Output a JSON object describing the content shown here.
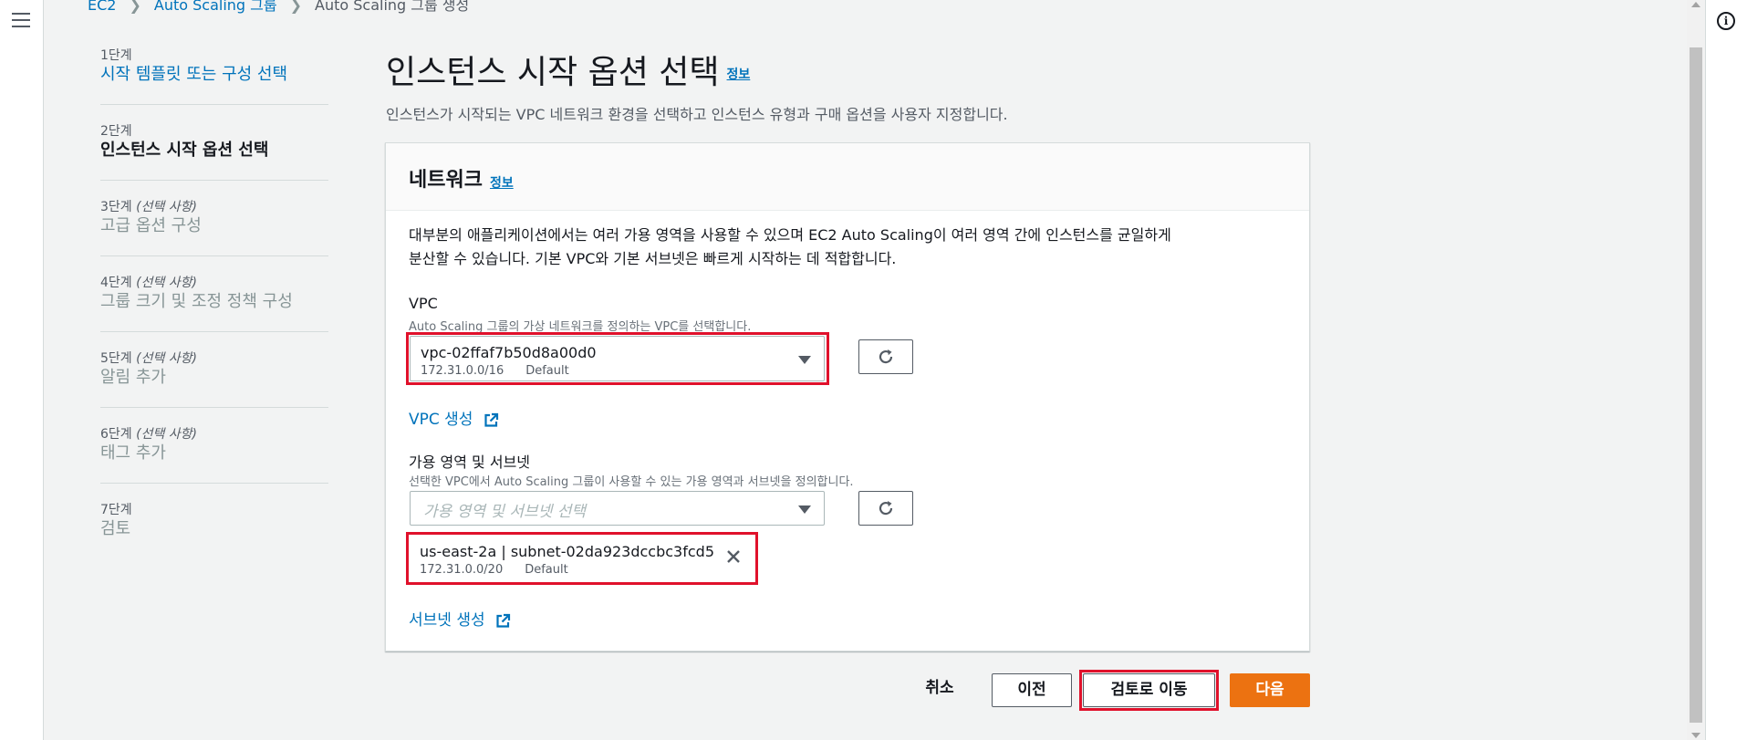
{
  "breadcrumb": {
    "items": [
      "EC2",
      "Auto Scaling 그룹",
      "Auto Scaling 그룹 생성"
    ]
  },
  "steps": [
    {
      "num": "1단계",
      "optional": "",
      "title": "시작 템플릿 또는 구성 선택",
      "state": "link"
    },
    {
      "num": "2단계",
      "optional": "",
      "title": "인스턴스 시작 옵션 선택",
      "state": "current"
    },
    {
      "num": "3단계",
      "optional": "(선택 사항)",
      "title": "고급 옵션 구성",
      "state": "disabled"
    },
    {
      "num": "4단계",
      "optional": "(선택 사항)",
      "title": "그룹 크기 및 조정 정책 구성",
      "state": "disabled"
    },
    {
      "num": "5단계",
      "optional": "(선택 사항)",
      "title": "알림 추가",
      "state": "disabled"
    },
    {
      "num": "6단계",
      "optional": "(선택 사항)",
      "title": "태그 추가",
      "state": "disabled"
    },
    {
      "num": "7단계",
      "optional": "",
      "title": "검토",
      "state": "disabled"
    }
  ],
  "page": {
    "title": "인스턴스 시작 옵션 선택",
    "info": "정보",
    "description": "인스턴스가 시작되는 VPC 네트워크 환경을 선택하고 인스턴스 유형과 구매 옵션을 사용자 지정합니다."
  },
  "network": {
    "title": "네트워크",
    "info": "정보",
    "desc_line1": "대부분의 애플리케이션에서는 여러 가용 영역을 사용할 수 있으며 EC2 Auto Scaling이 여러 영역 간에 인스턴스를 균일하게",
    "desc_line2": "분산할 수 있습니다. 기본 VPC와 기본 서브넷은 빠르게 시작하는 데 적합합니다.",
    "vpc": {
      "label": "VPC",
      "hint": "Auto Scaling 그룹의 가상 네트워크를 정의하는 VPC를 선택합니다.",
      "value": "vpc-02ffaf7b50d8a00d0",
      "cidr": "172.31.0.0/16",
      "tag": "Default",
      "create_link": "VPC 생성"
    },
    "subnets": {
      "label": "가용 영역 및 서브넷",
      "hint": "선택한 VPC에서 Auto Scaling 그룹이 사용할 수 있는 가용 영역과 서브넷을 정의합니다.",
      "placeholder": "가용 영역 및 서브넷 선택",
      "selected": {
        "value": "us-east-2a | subnet-02da923dccbc3fcd5",
        "cidr": "172.31.0.0/20",
        "tag": "Default"
      },
      "create_link": "서브넷 생성"
    }
  },
  "actions": {
    "cancel": "취소",
    "previous": "이전",
    "skip_to_review": "검토로 이동",
    "next": "다음"
  },
  "colors": {
    "link": "#0073bb",
    "primary": "#ec7211",
    "highlight": "#e0112b"
  }
}
